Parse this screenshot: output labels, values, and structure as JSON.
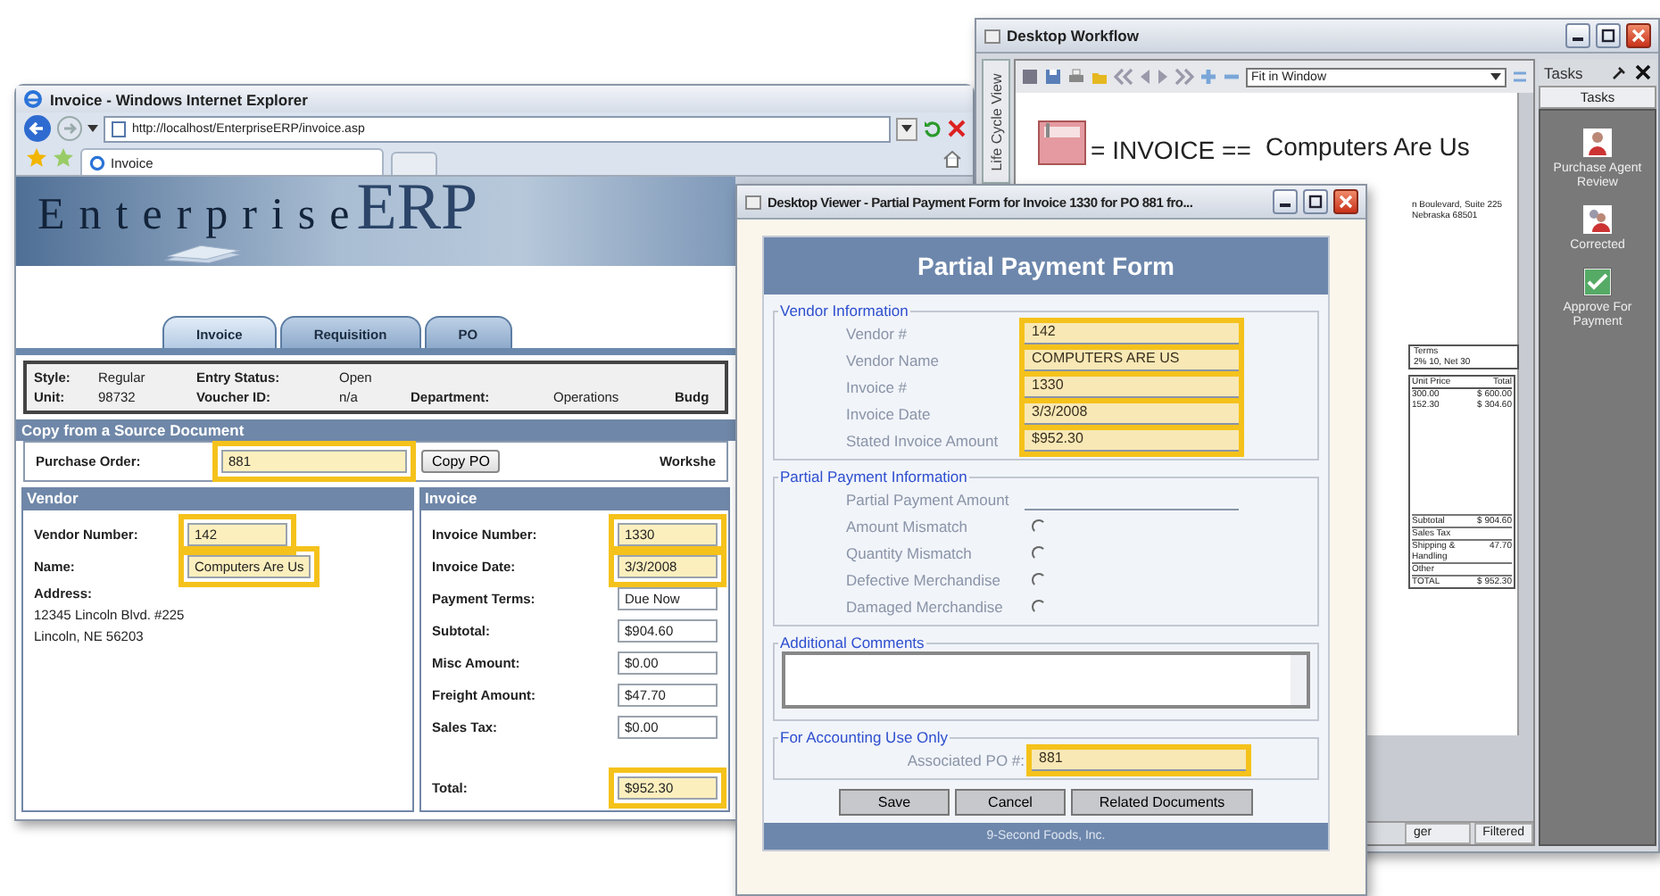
{
  "browser": {
    "title": "Invoice - Windows Internet Explorer",
    "address": "http://localhost/EnterpriseERP/invoice.asp",
    "tab": "Invoice",
    "banner": {
      "first": "Enterprise",
      "second": "ERP"
    },
    "tabs": [
      {
        "label": "Invoice",
        "selected": true
      },
      {
        "label": "Requisition",
        "selected": false
      },
      {
        "label": "PO",
        "selected": false
      }
    ],
    "info_rows": [
      [
        {
          "label": "Style:",
          "value": "Regular"
        },
        {
          "label": "Entry Status:",
          "value": "Open"
        }
      ],
      [
        {
          "label": "Unit:",
          "value": "98732"
        },
        {
          "label": "Voucher ID:",
          "value": "n/a"
        },
        {
          "label": "Department:",
          "value": "Operations"
        },
        {
          "label": "Budg"
        }
      ]
    ],
    "copy_section": {
      "title": "Copy from a Source Document",
      "label": "Purchase Order:",
      "value": "881",
      "highlighted": true,
      "button": "Copy PO",
      "side_label": "Workshe"
    },
    "vendor": {
      "title": "Vendor",
      "fields": [
        {
          "label": "Vendor Number:",
          "value": "142",
          "highlighted": true
        },
        {
          "label": "Name:",
          "value": "Computers Are Us",
          "highlighted": true
        }
      ],
      "address_label": "Address:",
      "address_lines": [
        "12345 Lincoln Blvd. #225",
        "Lincoln, NE 56203"
      ]
    },
    "invoice": {
      "title": "Invoice",
      "fields": [
        {
          "label": "Invoice Number:",
          "value": "1330",
          "highlighted": true
        },
        {
          "label": "Invoice Date:",
          "value": "3/3/2008",
          "highlighted": true
        },
        {
          "label": "Payment Terms:",
          "value": "Due Now",
          "highlighted": false
        },
        {
          "label": "Subtotal:",
          "value": "$904.60",
          "highlighted": false
        },
        {
          "label": "Misc Amount:",
          "value": "$0.00",
          "highlighted": false
        },
        {
          "label": "Freight Amount:",
          "value": "$47.70",
          "highlighted": false
        },
        {
          "label": "Sales Tax:",
          "value": "$0.00",
          "highlighted": false
        }
      ],
      "total": {
        "label": "Total:",
        "value": "$952.30",
        "highlighted": true
      }
    }
  },
  "workflow": {
    "title": "Desktop Workflow",
    "side_tab": "Life Cycle View",
    "zoom_select": "Fit in Window",
    "document": {
      "heading": "= INVOICE ==",
      "company": "Computers Are Us",
      "address_lines": [
        "n Boulevard, Suite 225",
        "Nebraska 68501"
      ],
      "terms": {
        "header": "Terms",
        "value": "2% 10, Net 30"
      },
      "items_columns": [
        "Unit Price",
        "Total"
      ],
      "items_rows": [
        [
          "300.00",
          "$ 600.00"
        ],
        [
          "152.30",
          "$ 304.60"
        ]
      ],
      "summary": [
        {
          "label": "Subtotal",
          "value": "$ 904.60"
        },
        {
          "label": "Sales Tax"
        },
        {
          "label": "Shipping & Handling",
          "value": "47.70"
        },
        {
          "label": "Other"
        },
        {
          "label": "TOTAL",
          "value": "$ 952.30"
        }
      ]
    },
    "status_bar": [
      "ger",
      "Filtered"
    ],
    "tasks": {
      "title": "Tasks",
      "header": "Tasks",
      "items": [
        {
          "label": "Purchase Agent Review",
          "kind": "person"
        },
        {
          "label": "Corrected",
          "kind": "people"
        },
        {
          "label": "Approve For Payment",
          "kind": "check"
        }
      ]
    }
  },
  "dialog": {
    "title": "Desktop Viewer - Partial Payment Form for Invoice 1330 for PO 881 fro...",
    "form_title": "Partial Payment Form",
    "vendor_section": {
      "legend": "Vendor Information",
      "fields": [
        {
          "label": "Vendor #",
          "value": "142",
          "highlighted": true
        },
        {
          "label": "Vendor Name",
          "value": "COMPUTERS ARE US",
          "highlighted": true
        },
        {
          "label": "Invoice #",
          "value": "1330",
          "highlighted": true
        },
        {
          "label": "Invoice Date",
          "value": "3/3/2008",
          "highlighted": true
        },
        {
          "label": "Stated Invoice Amount",
          "value": "$952.30",
          "highlighted": true
        }
      ]
    },
    "payment_section": {
      "legend": "Partial Payment Information",
      "amount_label": "Partial Payment Amount",
      "options": [
        {
          "label": "Amount Mismatch",
          "selected": false
        },
        {
          "label": "Quantity Mismatch",
          "selected": false
        },
        {
          "label": "Defective Merchandise",
          "selected": false
        },
        {
          "label": "Damaged Merchandise",
          "selected": false
        }
      ]
    },
    "comments_section": {
      "legend": "Additional Comments"
    },
    "accounting_section": {
      "legend": "For Accounting Use Only",
      "label": "Associated PO #:",
      "value": "881",
      "highlighted": true
    },
    "buttons": [
      "Save",
      "Cancel",
      "Related Documents"
    ],
    "footer": "9-Second Foods, Inc."
  }
}
